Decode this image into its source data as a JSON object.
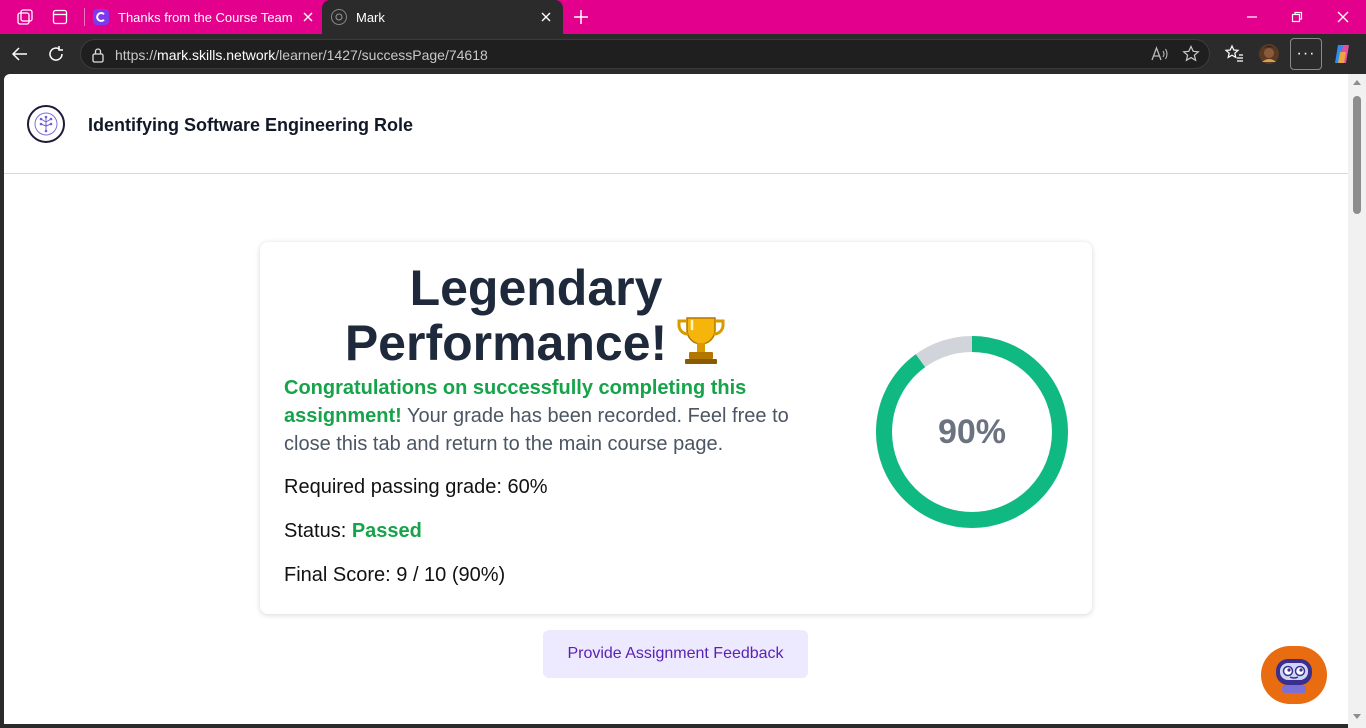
{
  "browser": {
    "tabs": [
      {
        "title": "Thanks from the Course Team | Co",
        "active": false
      },
      {
        "title": "Mark",
        "active": true
      }
    ],
    "url_prefix": "https://",
    "url_host": "mark.skills.network",
    "url_path": "/learner/1427/successPage/74618",
    "accent_color": "#e3008c"
  },
  "header": {
    "course_title": "Identifying Software Engineering Role"
  },
  "result": {
    "headline_line1": "Legendary",
    "headline_line2": "Performance!",
    "congrats_bold": "Congratulations on successfully completing this assignment!",
    "congrats_rest": " Your grade has been recorded. Feel free to close this tab and return to the main course page.",
    "passing_grade": "Required passing grade: 60%",
    "status_label": "Status:",
    "status_value": "Passed",
    "final_score": "Final Score: 9 / 10 (90%)",
    "percent_label": "90%",
    "score_fraction": 0.9,
    "ring_color": "#10b981",
    "ring_track_color": "#d1d5db"
  },
  "actions": {
    "feedback_label": "Provide Assignment Feedback"
  }
}
